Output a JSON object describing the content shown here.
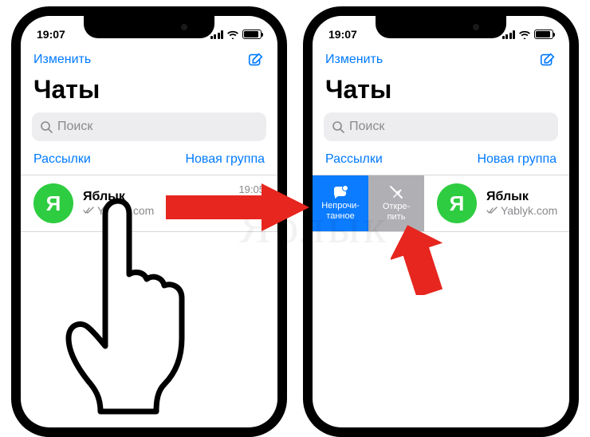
{
  "status": {
    "time": "19:07"
  },
  "nav": {
    "edit": "Изменить"
  },
  "header": {
    "title": "Чаты"
  },
  "search": {
    "placeholder": "Поиск"
  },
  "links": {
    "broadcasts": "Рассылки",
    "new_group": "Новая группа"
  },
  "chat": {
    "avatar_letter": "Я",
    "name": "Яблык",
    "preview": "Yablyk.com",
    "time": "19:05"
  },
  "swipe": {
    "unread_l1": "Непрочи-",
    "unread_l2": "танное",
    "unpin_l1": "Откре-",
    "unpin_l2": "пить"
  },
  "watermark": "Яблык"
}
